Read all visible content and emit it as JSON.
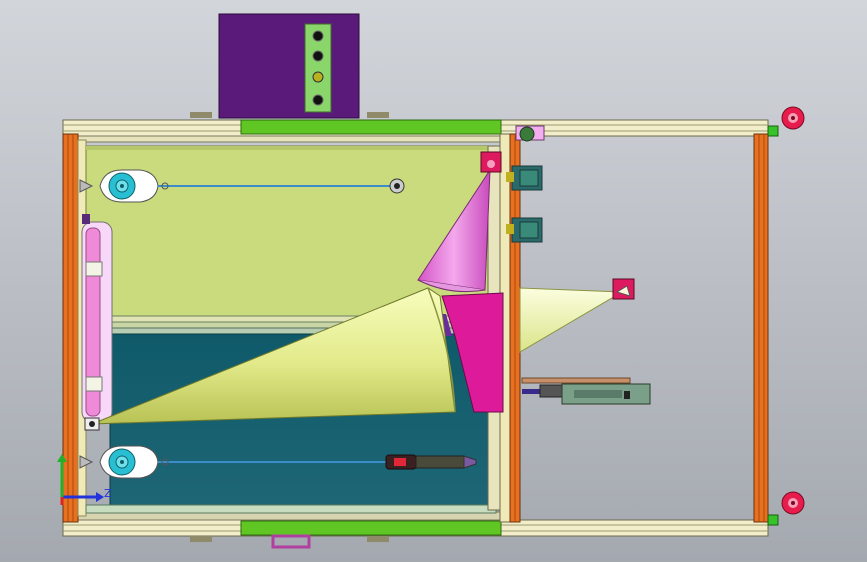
{
  "viewport": {
    "background_top": "#cfd3d8",
    "background_bottom": "#a7abb2"
  },
  "axis_triad": {
    "z_label": "Z"
  },
  "colors": {
    "frame_cream": "#f2eecc",
    "frame_green": "#5fc623",
    "frame_orange": "#e8701e",
    "upper_panel": "#c9db7c",
    "lower_panel": "#1c5f6f",
    "control_box": "#5a1a7a",
    "control_strip": "#8bd66a",
    "cone_light": "#f5fbb0",
    "cone_dark": "#c4cd5c",
    "cone_pink": "#e874d8",
    "magenta_block": "#dd1a9a",
    "reel_cyan": "#28bfd2",
    "cable_blue": "#3b8cc9",
    "red_marker": "#e81c4c"
  }
}
